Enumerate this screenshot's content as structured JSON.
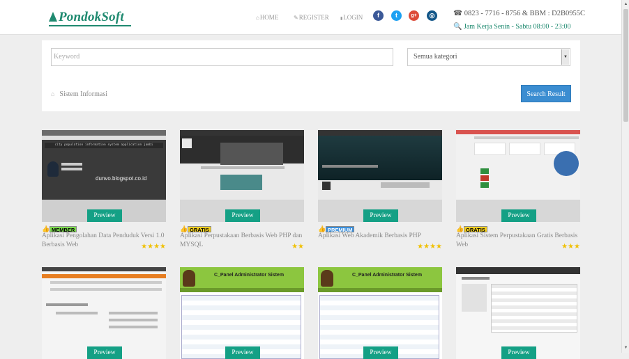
{
  "header": {
    "logo_text": "PondokSoft",
    "nav": [
      {
        "icon": "home-icon",
        "glyph": "⌂",
        "label": "HOME"
      },
      {
        "icon": "edit-icon",
        "glyph": "✎",
        "label": "REGISTER"
      },
      {
        "icon": "lock-icon",
        "glyph": "🔒",
        "label": "LOGIN"
      }
    ],
    "social": [
      {
        "icon": "facebook-icon",
        "glyph": "f",
        "color": "#3b5998"
      },
      {
        "icon": "twitter-icon",
        "glyph": "t",
        "color": "#1da1f2"
      },
      {
        "icon": "google-plus-icon",
        "glyph": "g+",
        "color": "#dd4b39"
      },
      {
        "icon": "instagram-icon",
        "glyph": "◎",
        "color": "#125688"
      }
    ],
    "contact_phone": "☎ 0823 - 7716 - 8756 &  BBM : D2B0955C",
    "contact_hours": "🔍 Jam Kerja Senin - Sabtu 08:00 - 23:00"
  },
  "search": {
    "keyword_placeholder": "Keyword",
    "category_selected": "Semua kategori",
    "breadcrumb": "Sistem Informasi",
    "result_button": "Search Result"
  },
  "cards": [
    {
      "preview": "Preview",
      "badge": "MEMBER",
      "badge_color": "#7fdf50",
      "title": "Aplikasi Pengolahan Data Penduduk Versi 1.0 Berbasis Web",
      "stars": "★★★★",
      "thumb_caption": "dunvo.blogspot.co.id"
    },
    {
      "preview": "Preview",
      "badge": "GRATIS",
      "badge_color": "#f5d020",
      "title": "Aplikasi Perpustakaan Berbasis Web PHP dan MYSQL",
      "stars": "★★"
    },
    {
      "preview": "Preview",
      "badge": "PREMIUM",
      "badge_color": "#3a8fdc",
      "title": "Aplikasi Web Akademik Berbasis PHP",
      "stars": "★★★★"
    },
    {
      "preview": "Preview",
      "badge": "GRATIS",
      "badge_color": "#f5d020",
      "title": "Aplikasi Sistem Perpustakaan Gratis Berbasis Web",
      "stars": "★★★"
    },
    {
      "preview": "Preview"
    },
    {
      "preview": "Preview",
      "thumb_caption": "C_Panel Administrator Sistem"
    },
    {
      "preview": "Preview",
      "thumb_caption": "C_Panel Administrator Sistem"
    },
    {
      "preview": "Preview"
    }
  ]
}
